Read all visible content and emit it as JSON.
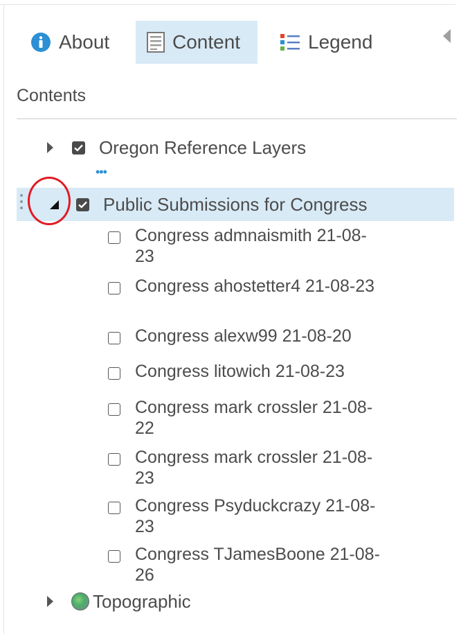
{
  "tabs": [
    {
      "label": "About",
      "icon": "info-icon",
      "active": false
    },
    {
      "label": "Content",
      "icon": "content-icon",
      "active": true
    },
    {
      "label": "Legend",
      "icon": "legend-icon",
      "active": false
    }
  ],
  "contents_heading": "Contents",
  "layers": {
    "oregon": {
      "label": "Oregon Reference Layers",
      "checked": true,
      "expanded": false
    },
    "public": {
      "label": "Public Submissions for Congress",
      "checked": true,
      "expanded": true
    },
    "sublayers": [
      {
        "label": "Congress admnaismith 21-08-23",
        "checked": false
      },
      {
        "label": "Congress ahostetter4 21-08-23",
        "checked": false
      },
      {
        "label": "Congress alexw99 21-08-20",
        "checked": false
      },
      {
        "label": "Congress litowich 21-08-23",
        "checked": false
      },
      {
        "label": "Congress mark crossler 21-08-22",
        "checked": false
      },
      {
        "label": "Congress mark crossler 21-08-23",
        "checked": false
      },
      {
        "label": "Congress Psyduckcrazy 21-08-23",
        "checked": false
      },
      {
        "label": "Congress TJamesBoone 21-08-26",
        "checked": false
      }
    ],
    "topographic": {
      "label": "Topographic",
      "expanded": false
    }
  },
  "colors": {
    "accent": "#d8eaf6",
    "info_blue": "#2d8fd5",
    "annotation_red": "#e01b24"
  }
}
